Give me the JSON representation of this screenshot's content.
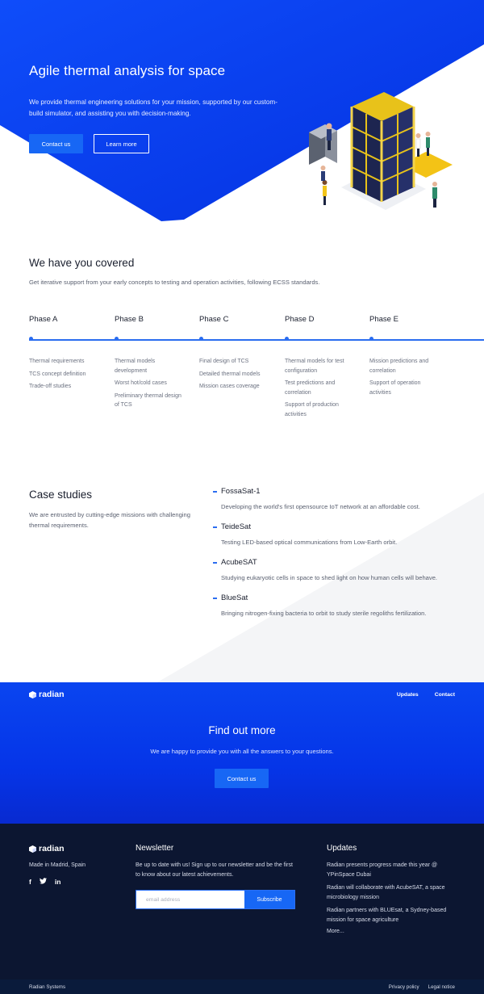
{
  "hero": {
    "title": "Agile thermal analysis for space",
    "description": "We provide thermal engineering solutions for your mission, supported by our custom-build simulator, and assisting you with decision-making.",
    "primary_button": "Contact us",
    "secondary_button": "Learn more"
  },
  "covered": {
    "title": "We have you covered",
    "subtitle": "Get iterative support from your early concepts to testing and operation activities, following ECSS standards.",
    "phases": [
      {
        "title": "Phase A",
        "items": [
          "Thermal requirements",
          "TCS concept definition",
          "Trade-off studies"
        ]
      },
      {
        "title": "Phase B",
        "items": [
          "Thermal models development",
          "Worst hot/cold cases",
          "Preliminary thermal design of TCS"
        ]
      },
      {
        "title": "Phase C",
        "items": [
          "Final design of TCS",
          "Detailed thermal models",
          "Mission cases coverage"
        ]
      },
      {
        "title": "Phase D",
        "items": [
          "Thermal models for test configuration",
          "Test predictions and correlation",
          "Support of production activities"
        ]
      },
      {
        "title": "Phase E",
        "items": [
          "Mission predictions and correlation",
          "Support of operation activities"
        ]
      }
    ]
  },
  "cases": {
    "title": "Case studies",
    "description": "We are entrusted by cutting-edge missions with challenging thermal requirements.",
    "items": [
      {
        "name": "FossaSat-1",
        "desc": "Developing the world's first opensource IoT network at an affordable cost."
      },
      {
        "name": "TeideSat",
        "desc": "Testing LED-based optical communications from Low-Earth orbit."
      },
      {
        "name": "AcubeSAT",
        "desc": "Studying eukaryotic cells in space to shed light on how human cells will behave."
      },
      {
        "name": "BlueSat",
        "desc": "Bringing nitrogen-fixing bacteria to orbit to study sterile regoliths fertilization."
      }
    ]
  },
  "nav": {
    "logo": "radian",
    "links": [
      "Updates",
      "Contact"
    ]
  },
  "cta": {
    "title": "Find out more",
    "description": "We are happy to provide you with all the answers to your questions.",
    "button": "Contact us"
  },
  "footer": {
    "logo": "radian",
    "location": "Made in Madrid, Spain",
    "socials": [
      "facebook-icon",
      "twitter-icon",
      "linkedin-icon"
    ],
    "newsletter_title": "Newsletter",
    "newsletter_text": "Be up to date with us! Sign up to our newsletter and be the first to know about our latest achievements.",
    "email_placeholder": "email address",
    "subscribe_label": "Subscribe",
    "updates_title": "Updates",
    "updates": [
      "Radian presents progress made this year @ YPinSpace Dubai",
      "Radian will collaborate with AcubeSAT, a space microbiology mission",
      "Radian partners with BLUEsat, a Sydney-based mission for space agriculture"
    ],
    "more": "More...",
    "company": "Radian Systems",
    "privacy": "Privacy policy",
    "legal": "Legal notice"
  },
  "colors": {
    "brand_blue": "#0a45f0",
    "accent_blue": "#1767f5",
    "footer_navy": "#0c1631"
  }
}
